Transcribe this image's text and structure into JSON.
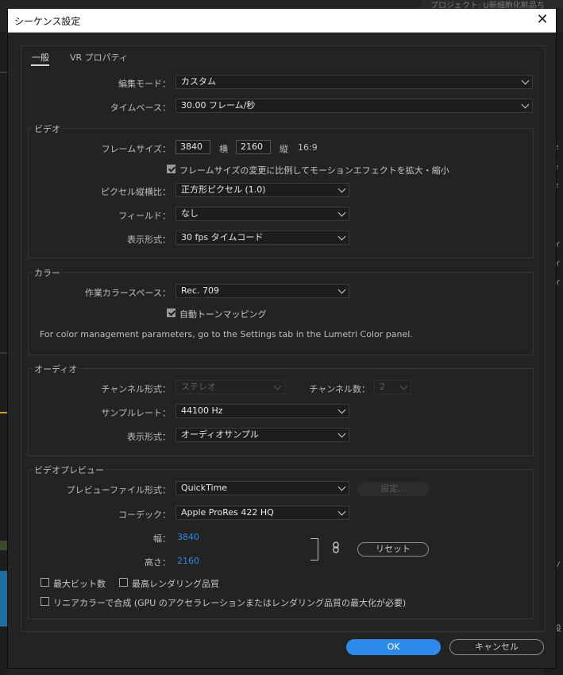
{
  "background": {
    "top_text": "プロジェクト: U新細胞化粧品ち",
    "right_fragments": [
      "e",
      "e",
      "e",
      "ィ",
      "ィ",
      "ィ",
      "ノ",
      "役"
    ]
  },
  "dialog": {
    "title": "シーケンス設定",
    "close_label": "✕",
    "tabs": [
      {
        "label": "一般",
        "active": true
      },
      {
        "label": "VR プロパティ",
        "active": false
      }
    ],
    "edit_mode": {
      "label": "編集モード：",
      "value": "カスタム"
    },
    "timebase": {
      "label": "タイムベース：",
      "value": "30.00  フレーム/秒"
    },
    "video": {
      "group_label": "ビデオ",
      "frame_size_label": "フレームサイズ：",
      "frame_width": "3840",
      "horizontal_label": "横",
      "frame_height": "2160",
      "vertical_label": "縦",
      "aspect": "16:9",
      "scale_checkbox": {
        "label": "フレームサイズの変更に比例してモーションエフェクトを拡大・縮小",
        "checked": true
      },
      "pixel_aspect": {
        "label": "ピクセル縦横比：",
        "value": "正方形ピクセル (1.0)"
      },
      "fields": {
        "label": "フィールド：",
        "value": "なし"
      },
      "display_format": {
        "label": "表示形式：",
        "value": "30  fps タイムコード"
      }
    },
    "color": {
      "group_label": "カラー",
      "working_space": {
        "label": "作業カラースペース：",
        "value": "Rec. 709"
      },
      "tone_mapping": {
        "label": "自動トーンマッピング",
        "checked": true
      },
      "note": "For color management parameters, go to the Settings tab in the Lumetri Color panel."
    },
    "audio": {
      "group_label": "オーディオ",
      "channel_format": {
        "label": "チャンネル形式：",
        "value": "ステレオ"
      },
      "channel_count": {
        "label": "チャンネル数：",
        "value": "2"
      },
      "sample_rate": {
        "label": "サンプルレート：",
        "value": "44100 Hz"
      },
      "display_format": {
        "label": "表示形式：",
        "value": "オーディオサンプル"
      }
    },
    "video_preview": {
      "group_label": "ビデオプレビュー",
      "file_format": {
        "label": "プレビューファイル形式：",
        "value": "QuickTime"
      },
      "settings_button": "設定...",
      "codec": {
        "label": "コーデック：",
        "value": "Apple ProRes 422 HQ"
      },
      "width_label": "幅：",
      "width_value": "3840",
      "height_label": "高さ：",
      "height_value": "2160",
      "reset_button": "リセット",
      "max_bit_depth": {
        "label": "最大ビット数",
        "checked": false
      },
      "max_render_quality": {
        "label": "最高レンダリング品質",
        "checked": false
      },
      "linear_color": {
        "label": "リニアカラーで合成 (GPU のアクセラレーションまたはレンダリング品質の最大化が必要)",
        "checked": false
      }
    },
    "ok_button": "OK",
    "cancel_button": "キャンセル"
  }
}
